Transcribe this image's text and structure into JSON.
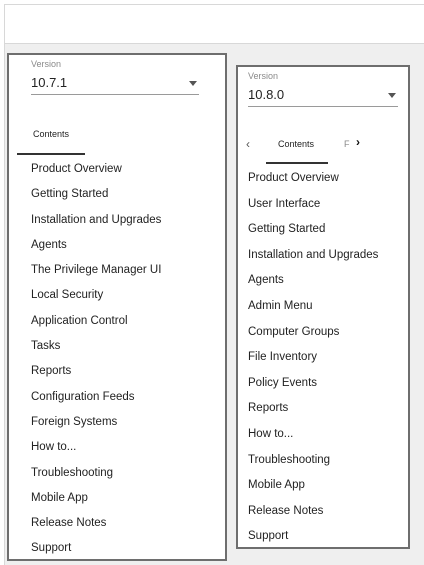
{
  "left_panel": {
    "version": {
      "label": "Version",
      "value": "10.7.1"
    },
    "tabs": {
      "active": "Contents"
    },
    "items": [
      "Product Overview",
      "Getting Started",
      "Installation and Upgrades",
      "Agents",
      "The Privilege Manager UI",
      "Local Security",
      "Application Control",
      "Tasks",
      "Reports",
      "Configuration Feeds",
      "Foreign Systems",
      "How to...",
      "Troubleshooting",
      "Mobile App",
      "Release Notes",
      "Support"
    ]
  },
  "right_panel": {
    "version": {
      "label": "Version",
      "value": "10.8.0"
    },
    "tabs": {
      "active": "Contents",
      "next_partial": "F",
      "prev_icon": "chevron-left-icon",
      "next_icon": "chevron-right-icon"
    },
    "items": [
      "Product Overview",
      "User Interface",
      "Getting Started",
      "Installation and Upgrades",
      "Agents",
      "Admin Menu",
      "Computer Groups",
      "File Inventory",
      "Policy Events",
      "Reports",
      "How to...",
      "Troubleshooting",
      "Mobile App",
      "Release Notes",
      "Support"
    ]
  },
  "colors": {
    "panel_border": "#6e6e6e",
    "background": "#efefef",
    "text": "#222222",
    "muted": "#8a8a8a"
  }
}
